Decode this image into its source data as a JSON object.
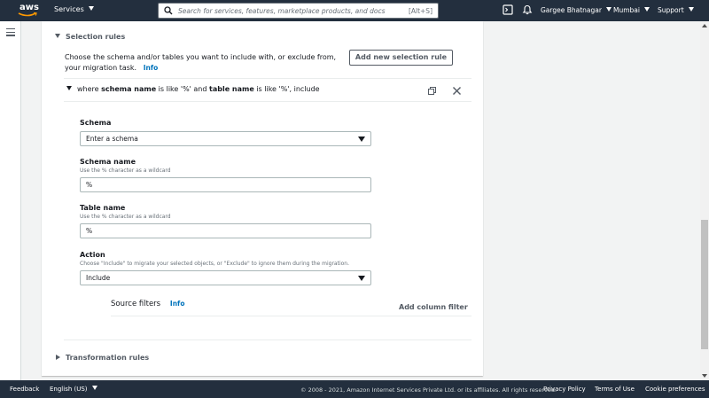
{
  "topnav": {
    "logo_text": "aws",
    "services_label": "Services",
    "search_placeholder": "Search for services, features, marketplace products, and docs",
    "search_shortcut": "[Alt+S]",
    "user_name": "Gargee Bhatnagar",
    "region": "Mumbai",
    "support": "Support"
  },
  "selection_rules": {
    "title": "Selection rules",
    "description": "Choose the schema and/or tables you want to include with, or exclude from, your migration task.",
    "info": "Info",
    "add_button": "Add new selection rule",
    "rule": {
      "prefix": "where",
      "schema_key": "schema name",
      "mid1": "is like '%' and",
      "table_key": "table name",
      "mid2": "is like '%', include"
    },
    "schema": {
      "label": "Schema",
      "placeholder": "Enter a schema"
    },
    "schema_name": {
      "label": "Schema name",
      "hint": "Use the % character as a wildcard",
      "value": "%"
    },
    "table_name": {
      "label": "Table name",
      "hint": "Use the % character as a wildcard",
      "value": "%"
    },
    "action": {
      "label": "Action",
      "hint": "Choose \"Include\" to migrate your selected objects, or \"Exclude\" to ignore them during the migration.",
      "value": "Include"
    },
    "source_filters": {
      "label": "Source filters",
      "info": "Info",
      "add_column": "Add column filter"
    }
  },
  "transformation_rules": {
    "title": "Transformation rules"
  },
  "footer": {
    "feedback": "Feedback",
    "language": "English (US)",
    "copyright": "© 2008 - 2021, Amazon Internet Services Private Ltd. or its affiliates. All rights reserved.",
    "privacy": "Privacy Policy",
    "terms": "Terms of Use",
    "cookies": "Cookie preferences"
  },
  "colors": {
    "nav_bg": "#232f3e",
    "link": "#0073bb",
    "background": "#f2f3f3"
  }
}
